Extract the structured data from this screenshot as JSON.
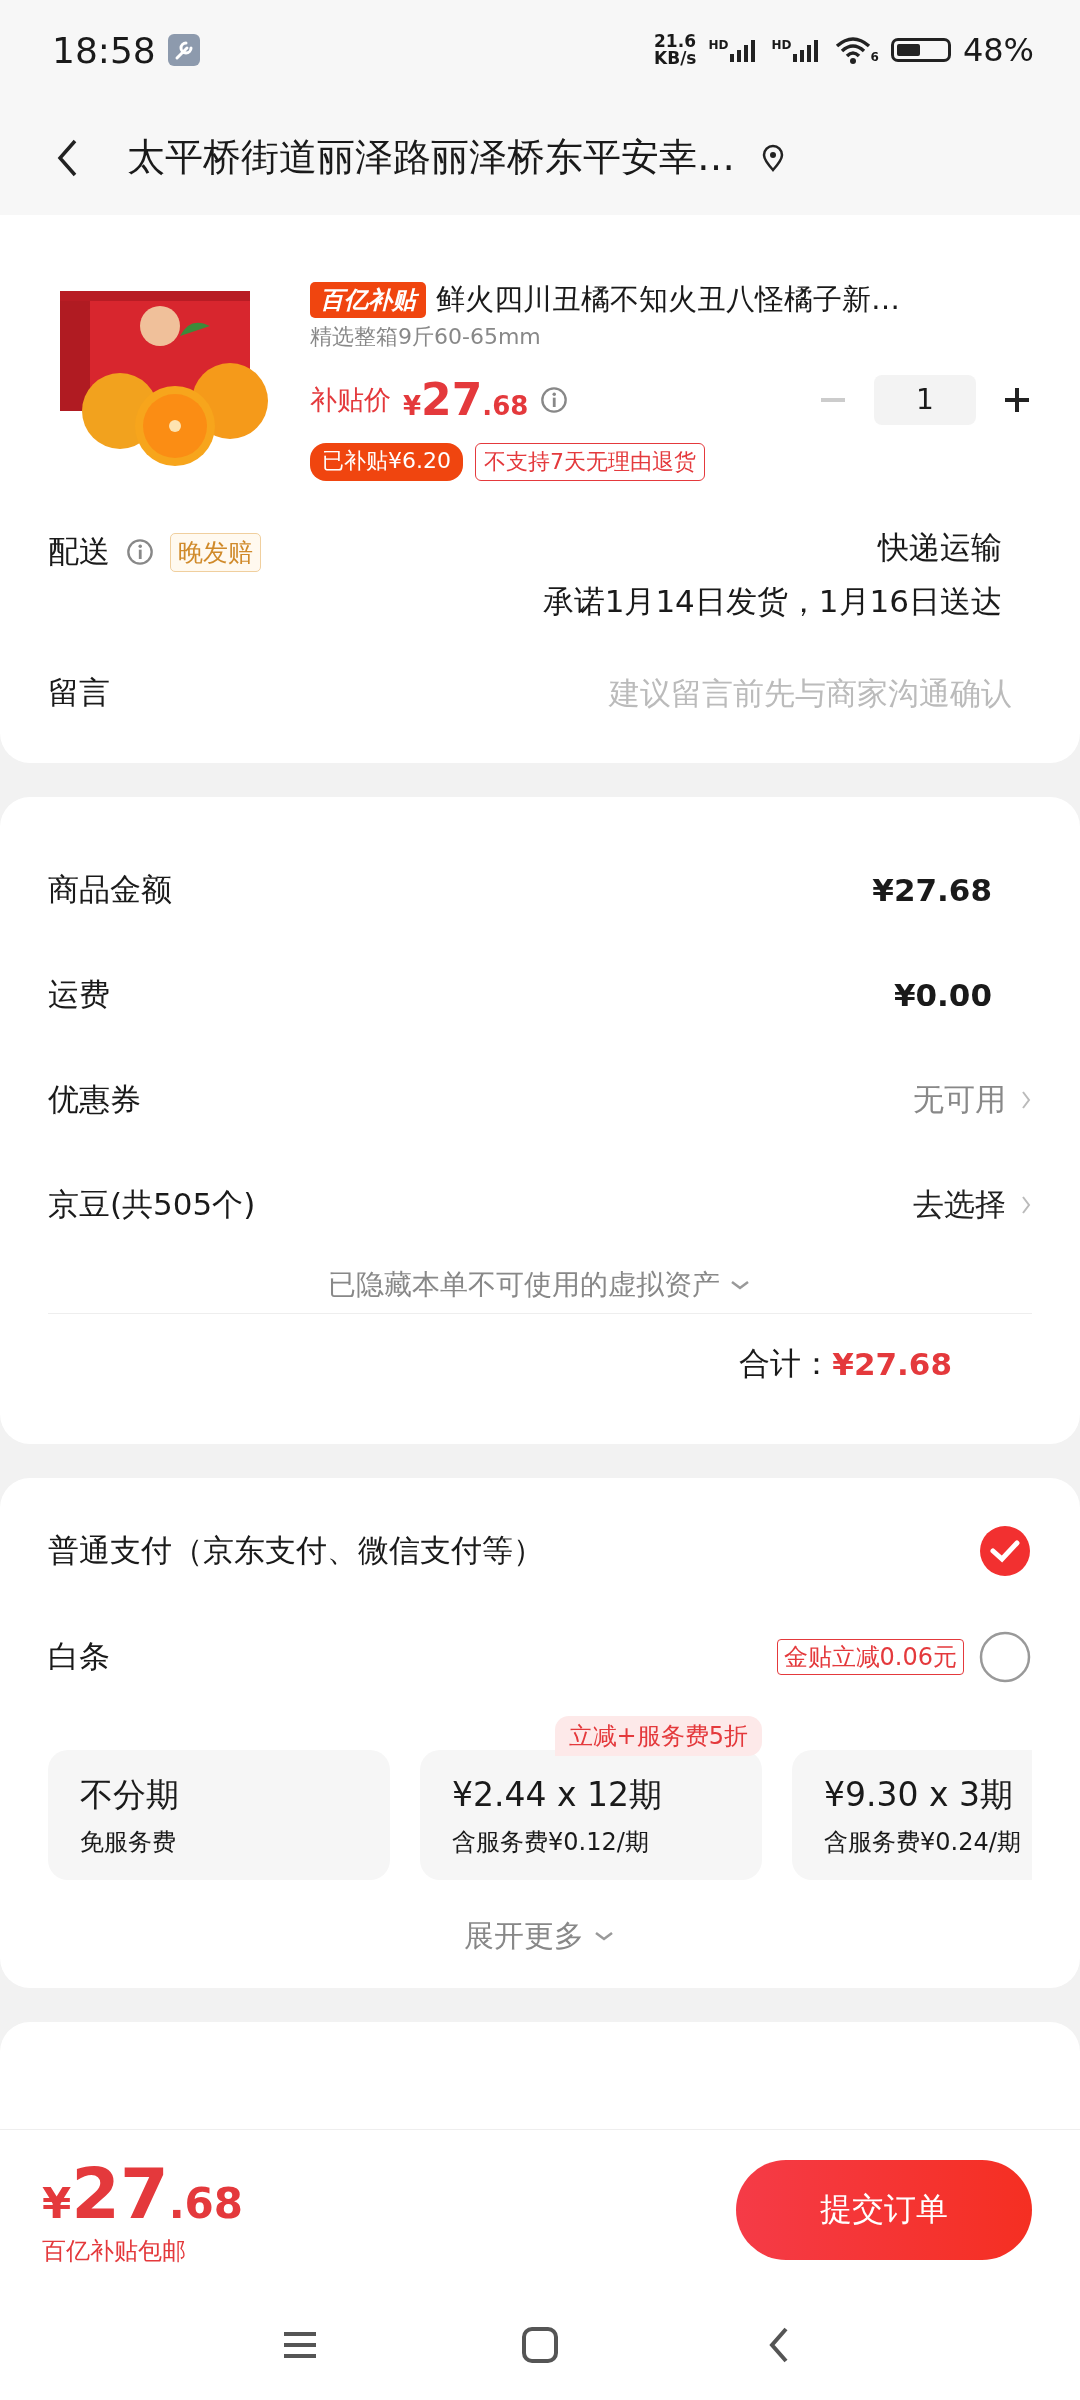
{
  "status_bar": {
    "time": "18:58",
    "speed_value": "21.6",
    "speed_unit": "KB/s",
    "sim_labels": [
      "HD",
      "HD"
    ],
    "wifi_generation": "6",
    "battery_text": "48%"
  },
  "header": {
    "address": "太平桥街道丽泽路丽泽桥东平安幸…"
  },
  "product": {
    "badge": "百亿补贴",
    "title": "鲜火四川丑橘不知火丑八怪橘子新…",
    "spec": "精选整箱9斤60-65mm",
    "price_label": "补贴价",
    "price_symbol": "¥",
    "price_int": "27",
    "price_dec": ".68",
    "quantity": "1",
    "minus_disabled": true,
    "tags": [
      {
        "kind": "filled",
        "text": "已补贴¥6.20"
      },
      {
        "kind": "outline",
        "text": "不支持7天无理由退货"
      }
    ]
  },
  "delivery": {
    "label": "配送",
    "tag": "晚发赔",
    "method": "快递运输",
    "promise": "承诺1月14日发货，1月16日送达"
  },
  "message": {
    "label": "留言",
    "placeholder": "建议留言前先与商家沟通确认"
  },
  "summary": {
    "rows": [
      {
        "kind": "amount",
        "label": "商品金额",
        "value": "¥27.68"
      },
      {
        "kind": "amount",
        "label": "运费",
        "value": "¥0.00"
      },
      {
        "kind": "link",
        "label": "优惠券",
        "value": "无可用"
      },
      {
        "kind": "link",
        "label": "京豆(共505个)",
        "value": "去选择"
      }
    ],
    "hidden_note": "已隐藏本单不可使用的虚拟资产",
    "total_label": "合计：",
    "total_value": "¥27.68"
  },
  "payment": {
    "methods": [
      {
        "label": "普通支付（京东支付、微信支付等）",
        "checked": true
      },
      {
        "label": "白条",
        "promo": "金贴立减0.06元",
        "checked": false
      }
    ],
    "plans": [
      {
        "title": "不分期",
        "sub": "免服务费"
      },
      {
        "title": "¥2.44 x 12期",
        "sub": "含服务费¥0.12/期",
        "ribbon": "立减+服务费5折"
      },
      {
        "title": "¥9.30 x 3期",
        "sub": "含服务费¥0.24/期"
      }
    ],
    "more": "展开更多"
  },
  "bottom_bar": {
    "symbol": "¥",
    "int": "27",
    "dec": ".68",
    "note": "百亿补贴包邮",
    "submit": "提交订单"
  }
}
